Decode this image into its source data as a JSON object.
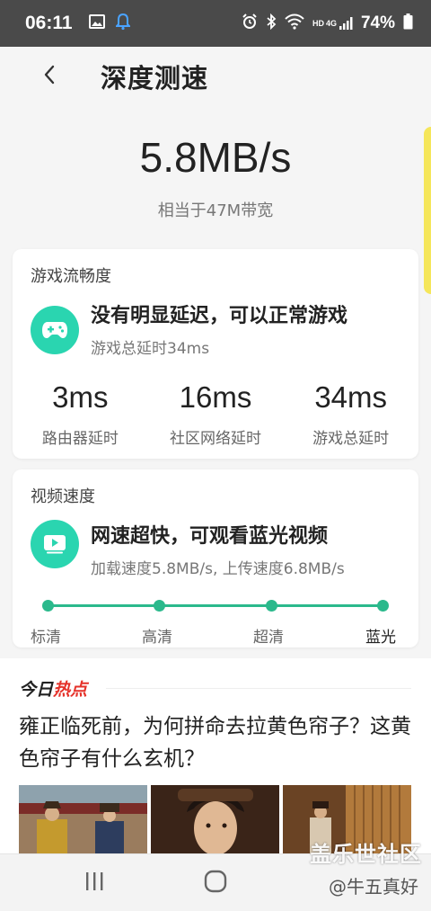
{
  "status_bar": {
    "time": "06:11",
    "battery": "74%",
    "signal_label": "4G",
    "hd_label": "HD"
  },
  "header": {
    "title": "深度测速"
  },
  "speed": {
    "value": "5.8MB/s",
    "bandwidth": "相当于47M带宽"
  },
  "game_card": {
    "label": "游戏流畅度",
    "headline": "没有明显延迟，可以正常游戏",
    "detail": "游戏总延时34ms",
    "metrics": [
      {
        "value": "3ms",
        "label": "路由器延时"
      },
      {
        "value": "16ms",
        "label": "社区网络延时"
      },
      {
        "value": "34ms",
        "label": "游戏总延时"
      }
    ],
    "accent": "#2ad5b0"
  },
  "video_card": {
    "label": "视频速度",
    "headline": "网速超快，可观看蓝光视频",
    "detail": "加载速度5.8MB/s, 上传速度6.8MB/s",
    "qualities": [
      "标清",
      "高清",
      "超清",
      "蓝光"
    ],
    "selected_quality": "蓝光",
    "accent": "#2bb98c"
  },
  "news": {
    "tag_prefix": "今日",
    "tag_hot": "热点",
    "title": "雍正临死前，为何拼命去拉黄色帘子？这黄色帘子有什么玄机？"
  },
  "watermark": {
    "line1": "盖乐世社区",
    "line2": "@牛五真好"
  },
  "icons": {
    "gallery": "gallery-icon",
    "notification": "bell-icon",
    "alarm": "alarm-icon",
    "bluetooth": "bluetooth-icon",
    "wifi": "wifi-icon",
    "signal": "signal-icon",
    "battery": "battery-icon",
    "back": "back-arrow-icon",
    "gamepad": "gamepad-icon",
    "play": "play-icon",
    "recents": "recents-icon",
    "home": "home-icon"
  }
}
